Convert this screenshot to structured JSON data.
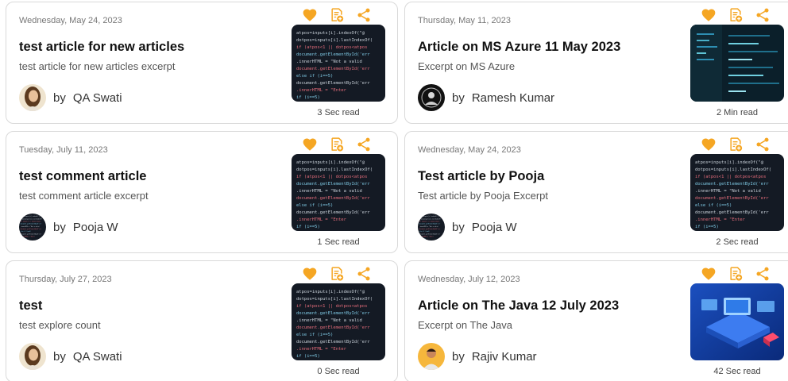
{
  "colors": {
    "accent": "#f5a623",
    "border": "#d9d9d9"
  },
  "icons": {
    "like": "heart-icon",
    "save": "bookmark-add-icon",
    "share": "share-icon"
  },
  "articles": [
    {
      "date": "Wednesday, May 24, 2023",
      "title": "test article for new articles",
      "excerpt": "test article for new articles excerpt",
      "by": "by",
      "author": "QA Swati",
      "avatar": "woman-portrait",
      "thumbnail": "code-screen",
      "read_time": "3 Sec read"
    },
    {
      "date": "Thursday, May 11, 2023",
      "title": "Article on MS Azure 11 May 2023",
      "excerpt": "Excerpt on MS Azure",
      "by": "by",
      "author": "Ramesh Kumar",
      "avatar": "dark-emblem",
      "thumbnail": "dark-code-screen",
      "read_time": "2 Min read"
    },
    {
      "date": "Tuesday, July 11, 2023",
      "title": "test comment article",
      "excerpt": "test comment article excerpt",
      "by": "by",
      "author": "Pooja W",
      "avatar": "code-screen",
      "thumbnail": "code-screen",
      "read_time": "1 Sec read"
    },
    {
      "date": "Wednesday, May 24, 2023",
      "title": "Test article by Pooja",
      "excerpt": "Test article by Pooja Excerpt",
      "by": "by",
      "author": "Pooja W",
      "avatar": "code-screen",
      "thumbnail": "code-screen",
      "read_time": "2 Sec read"
    },
    {
      "date": "Thursday, July 27, 2023",
      "title": "test",
      "excerpt": "test explore count",
      "by": "by",
      "author": "QA Swati",
      "avatar": "woman-portrait",
      "thumbnail": "code-screen",
      "read_time": "0 Sec read"
    },
    {
      "date": "Wednesday, July 12, 2023",
      "title": "Article on The Java 12 July 2023",
      "excerpt": "Excerpt on The Java",
      "by": "by",
      "author": "Rajiv Kumar",
      "avatar": "orange-portrait",
      "thumbnail": "blue-tech-illustration",
      "read_time": "42 Sec read"
    }
  ]
}
